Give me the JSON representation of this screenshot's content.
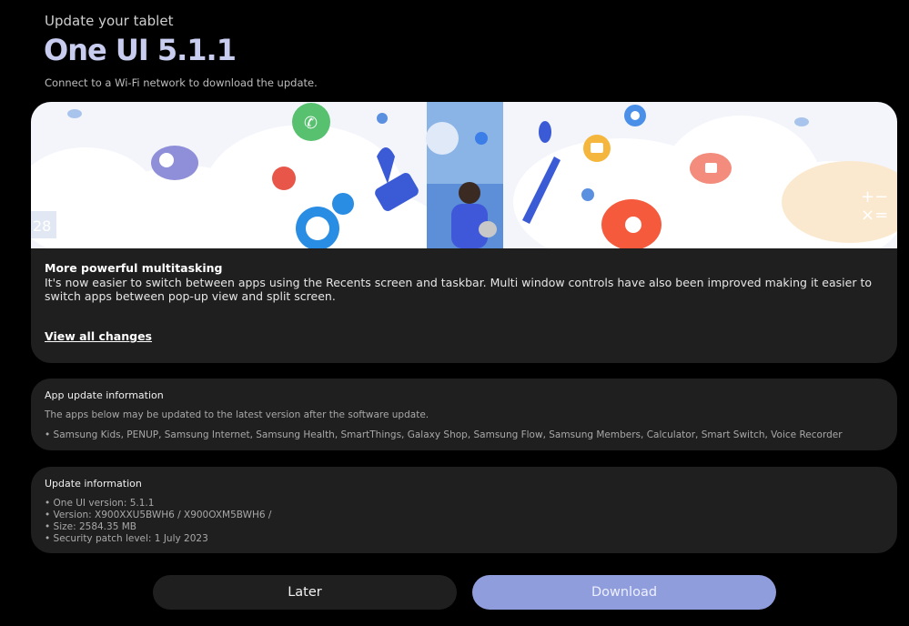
{
  "header": {
    "kicker": "Update your tablet",
    "title": "One UI 5.1.1",
    "subtitle": "Connect to a Wi-Fi network to download the update."
  },
  "feature": {
    "title": "More powerful multitasking",
    "description": "It's now easier to switch between apps using the Recents screen and taskbar. Multi window controls have also been improved making it easier to switch apps between pop-up view and split screen.",
    "link": "View all changes",
    "hero_calendar_day": "28"
  },
  "app_update": {
    "title": "App update information",
    "description": "The apps below may be updated to the latest version after the software update.",
    "apps": "• Samsung Kids, PENUP, Samsung Internet, Samsung Health, SmartThings, Galaxy Shop, Samsung Flow, Samsung Members, Calculator, Smart Switch, Voice Recorder"
  },
  "update_info": {
    "title": "Update information",
    "items": [
      "• One UI version: 5.1.1",
      "• Version: X900XXU5BWH6 / X900OXM5BWH6 /",
      "• Size: 2584.35 MB",
      "• Security patch level: 1 July 2023"
    ]
  },
  "buttons": {
    "later": "Later",
    "download": "Download"
  },
  "colors": {
    "background": "#000000",
    "card": "#1f1f1f",
    "title_accent": "#c8cdf0",
    "download_button": "#8f9ddd"
  },
  "icons": [
    "phone-icon",
    "chat-icon",
    "settings-icon",
    "folder-icon",
    "camera-icon",
    "flower-icon",
    "calculator-icon",
    "calendar-icon",
    "user-icon"
  ]
}
